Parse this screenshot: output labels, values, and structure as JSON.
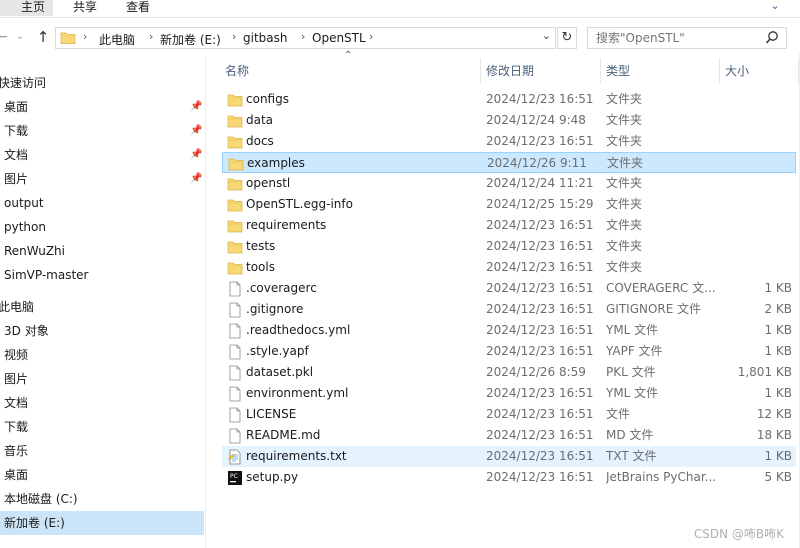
{
  "ribbon": {
    "tabs": [
      "主页",
      "共享",
      "查看"
    ]
  },
  "address": {
    "crumbs": [
      "此电脑",
      "新加卷 (E:)",
      "gitbash",
      "OpenSTL"
    ]
  },
  "search": {
    "placeholder": "搜索\"OpenSTL\""
  },
  "nav": {
    "quick_access": "快速访问",
    "pinned": [
      "桌面",
      "下载",
      "文档",
      "图片"
    ],
    "recent": [
      "output",
      "python",
      "RenWuZhi",
      "SimVP-master"
    ],
    "this_pc": "此电脑",
    "pc_items": [
      "3D 对象",
      "视频",
      "图片",
      "文档",
      "下载",
      "音乐",
      "桌面",
      "本地磁盘 (C:)",
      "新加卷 (E:)"
    ]
  },
  "columns": {
    "name": "名称",
    "date": "修改日期",
    "type": "类型",
    "size": "大小"
  },
  "files": [
    {
      "name": "configs",
      "date": "2024/12/23 16:51",
      "type": "文件夹",
      "size": "",
      "icon": "folder-icon"
    },
    {
      "name": "data",
      "date": "2024/12/24 9:48",
      "type": "文件夹",
      "size": "",
      "icon": "folder-icon"
    },
    {
      "name": "docs",
      "date": "2024/12/23 16:51",
      "type": "文件夹",
      "size": "",
      "icon": "folder-icon"
    },
    {
      "name": "examples",
      "date": "2024/12/26 9:11",
      "type": "文件夹",
      "size": "",
      "icon": "folder-icon"
    },
    {
      "name": "openstl",
      "date": "2024/12/24 11:21",
      "type": "文件夹",
      "size": "",
      "icon": "folder-icon"
    },
    {
      "name": "OpenSTL.egg-info",
      "date": "2024/12/25 15:29",
      "type": "文件夹",
      "size": "",
      "icon": "folder-icon"
    },
    {
      "name": "requirements",
      "date": "2024/12/23 16:51",
      "type": "文件夹",
      "size": "",
      "icon": "folder-icon"
    },
    {
      "name": "tests",
      "date": "2024/12/23 16:51",
      "type": "文件夹",
      "size": "",
      "icon": "folder-icon"
    },
    {
      "name": "tools",
      "date": "2024/12/23 16:51",
      "type": "文件夹",
      "size": "",
      "icon": "folder-icon"
    },
    {
      "name": ".coveragerc",
      "date": "2024/12/23 16:51",
      "type": "COVERAGERC 文...",
      "size": "1 KB",
      "icon": "file-icon"
    },
    {
      "name": ".gitignore",
      "date": "2024/12/23 16:51",
      "type": "GITIGNORE 文件",
      "size": "2 KB",
      "icon": "file-icon"
    },
    {
      "name": ".readthedocs.yml",
      "date": "2024/12/23 16:51",
      "type": "YML 文件",
      "size": "1 KB",
      "icon": "file-icon"
    },
    {
      "name": ".style.yapf",
      "date": "2024/12/23 16:51",
      "type": "YAPF 文件",
      "size": "1 KB",
      "icon": "file-icon"
    },
    {
      "name": "dataset.pkl",
      "date": "2024/12/26 8:59",
      "type": "PKL 文件",
      "size": "1,801 KB",
      "icon": "file-icon"
    },
    {
      "name": "environment.yml",
      "date": "2024/12/23 16:51",
      "type": "YML 文件",
      "size": "1 KB",
      "icon": "file-icon"
    },
    {
      "name": "LICENSE",
      "date": "2024/12/23 16:51",
      "type": "文件",
      "size": "12 KB",
      "icon": "file-icon"
    },
    {
      "name": "README.md",
      "date": "2024/12/23 16:51",
      "type": "MD 文件",
      "size": "18 KB",
      "icon": "file-icon"
    },
    {
      "name": "requirements.txt",
      "date": "2024/12/23 16:51",
      "type": "TXT 文件",
      "size": "1 KB",
      "icon": "text-file-icon"
    },
    {
      "name": "setup.py",
      "date": "2024/12/23 16:51",
      "type": "JetBrains PyChar...",
      "size": "5 KB",
      "icon": "pycharm-file-icon"
    }
  ],
  "selected_file": "examples",
  "hover_file": "requirements.txt",
  "selected_nav": "新加卷 (E:)",
  "colors": {
    "selection": "#cce8ff",
    "selection_border": "#99d1ff",
    "hover": "#e5f3ff",
    "folder": "#f8d775",
    "nav_selected": "#cce4f7"
  },
  "watermark": "CSDN @咘B咘K"
}
